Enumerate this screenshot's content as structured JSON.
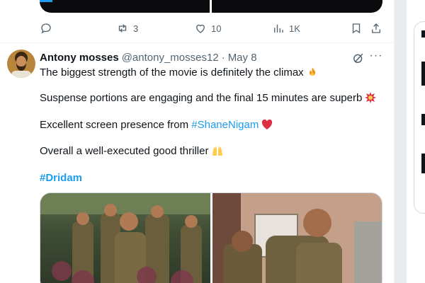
{
  "previous_tweet": {
    "actions": {
      "reply_count": "",
      "retweet_count": "3",
      "like_count": "10",
      "view_count": "1K"
    }
  },
  "tweet": {
    "display_name": "Antony mosses",
    "handle": "@antony_mosses12",
    "separator": "·",
    "date": "May 8",
    "more_label": "···",
    "lines": {
      "l1": "The biggest strength of the movie is definitely the climax",
      "l2": "Suspense portions are engaging and the final 15 minutes are superb",
      "l3_text": "Excellent screen presence from ",
      "l3_hashtag": "#ShaneNigam",
      "l4": "Overall a well-executed good thriller",
      "hashtag": "#Dridam"
    }
  },
  "colors": {
    "accent": "#1d9bf0",
    "text": "#0f1419",
    "muted": "#536471",
    "heart": "#e0245e"
  },
  "icons": [
    "reply-icon",
    "retweet-icon",
    "like-icon",
    "views-icon",
    "bookmark-icon",
    "share-icon",
    "grok-icon",
    "more-icon",
    "fire-emoji",
    "collision-emoji",
    "red-heart-emoji",
    "raised-hands-emoji"
  ]
}
